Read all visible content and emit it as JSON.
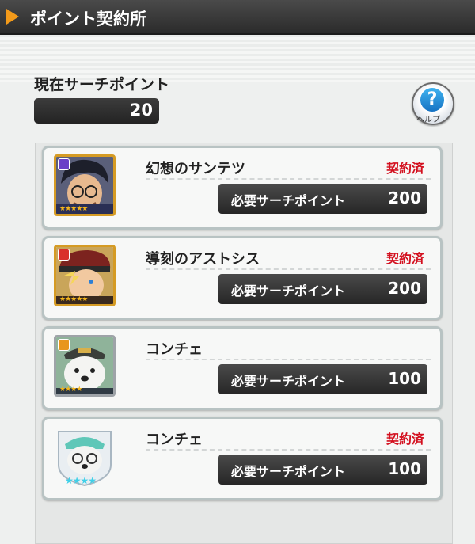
{
  "header": {
    "title": "ポイント契約所"
  },
  "search_points": {
    "label": "現在サーチポイント",
    "value": "20"
  },
  "help": {
    "icon_text": "?",
    "label": "ヘルプ"
  },
  "requirement_label": "必要サーチポイント",
  "items": [
    {
      "name": "幻想のサンテツ",
      "contracted": "契約済",
      "points": "200",
      "badge_color": "#6a3fc7",
      "portrait": "dark-haired-glasses",
      "stars": "★★★★★"
    },
    {
      "name": "導刻のアストシス",
      "contracted": "契約済",
      "points": "200",
      "badge_color": "#d9302a",
      "portrait": "blond-red-cap",
      "stars": "★★★★★"
    },
    {
      "name": "コンチェ",
      "contracted": "",
      "points": "100",
      "badge_color": "#e8961d",
      "portrait": "white-bear-officer",
      "stars": "★★★★"
    },
    {
      "name": "コンチェ",
      "contracted": "契約済",
      "points": "100",
      "badge_color": "",
      "portrait": "white-bear-teal-cap",
      "stars": "★★★★"
    }
  ]
}
